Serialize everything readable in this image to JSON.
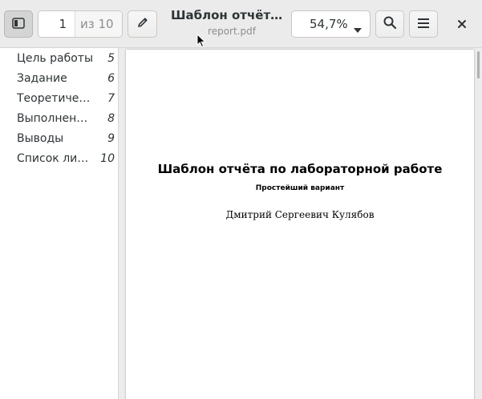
{
  "header": {
    "page_current": "1",
    "page_total": "из 10",
    "title": "Шаблон отчёта по лабораторной работе",
    "filename": "report.pdf",
    "zoom": "54,7%",
    "icons": {
      "sidebar": "sidebar-icon",
      "edit": "pencil-icon",
      "zoom_dropdown": "chevron-down-icon",
      "search": "search-icon",
      "menu": "hamburger-menu-icon",
      "close": "close-icon"
    }
  },
  "sidebar": {
    "items": [
      {
        "label": "Цель работы",
        "page": "5"
      },
      {
        "label": "Задание",
        "page": "6"
      },
      {
        "label": "Теоретическое введение",
        "page": "7"
      },
      {
        "label": "Выполнение лабораторной работы",
        "page": "8"
      },
      {
        "label": "Выводы",
        "page": "9"
      },
      {
        "label": "Список литературы",
        "page": "10"
      }
    ]
  },
  "document": {
    "title": "Шаблон отчёта по лабораторной работе",
    "subtitle": "Простейший вариант",
    "author": "Дмитрий Сергеевич Кулябов"
  },
  "colors": {
    "header_bg": "#ebebeb",
    "sidebar_bg": "#ffffff",
    "page_bg": "#ffffff",
    "text": "#2e3436",
    "muted": "#8b8e8f"
  }
}
